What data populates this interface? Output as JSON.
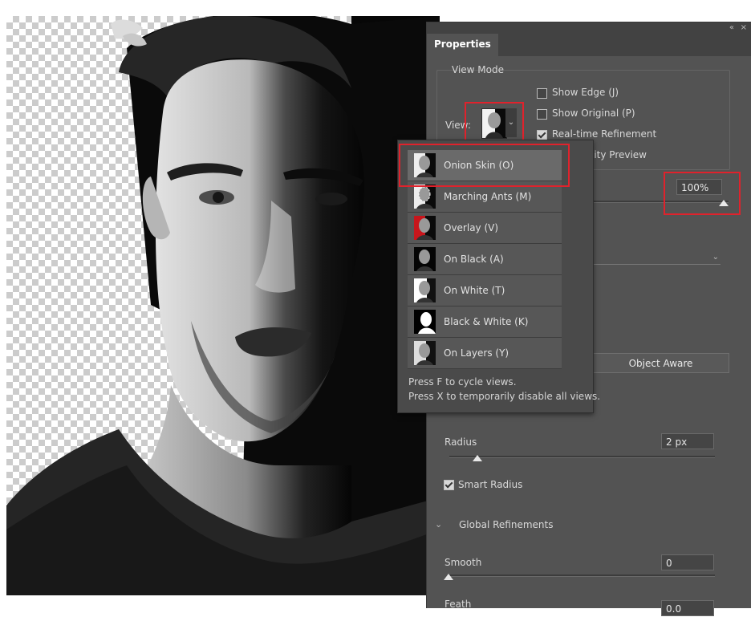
{
  "panel": {
    "tab": "Properties",
    "collapse_glyph": "«",
    "close_glyph": "×"
  },
  "view_mode": {
    "group_label": "View Mode",
    "view_label": "View:",
    "show_edge": "Show Edge (J)",
    "show_original": "Show Original (P)",
    "realtime": "Real-time Refinement",
    "quality_preview_partial": "lity Preview",
    "show_edge_checked": false,
    "show_original_checked": false,
    "realtime_checked": true
  },
  "opacity": {
    "value": "100%",
    "level_percent": 100
  },
  "object_aware_button": "Object Aware",
  "edge_detection": {
    "radius_label": "Radius",
    "radius_value": "2 px",
    "smart_radius_label": "Smart Radius",
    "smart_radius_checked": true
  },
  "global_refinements": {
    "label": "Global Refinements",
    "smooth_label": "Smooth",
    "smooth_value": "0",
    "next_label_partial": "Feath",
    "next_value_partial": "0.0"
  },
  "view_menu": {
    "items": [
      {
        "label": "Onion Skin (O)",
        "icon": "onion-skin-thumbnail",
        "selected": true
      },
      {
        "label": "Marching Ants (M)",
        "icon": "marching-ants-thumbnail",
        "selected": false
      },
      {
        "label": "Overlay (V)",
        "icon": "overlay-thumbnail",
        "selected": false
      },
      {
        "label": "On Black (A)",
        "icon": "on-black-thumbnail",
        "selected": false
      },
      {
        "label": "On White (T)",
        "icon": "on-white-thumbnail",
        "selected": false
      },
      {
        "label": "Black & White (K)",
        "icon": "black-white-thumbnail",
        "selected": false
      },
      {
        "label": "On Layers (Y)",
        "icon": "on-layers-thumbnail",
        "selected": false
      }
    ],
    "hint1": "Press F to cycle views.",
    "hint2": "Press X to temporarily disable all views."
  },
  "colors": {
    "panel_bg": "#535353",
    "highlight": "#e0222c",
    "overlay_red": "#c8161c"
  }
}
